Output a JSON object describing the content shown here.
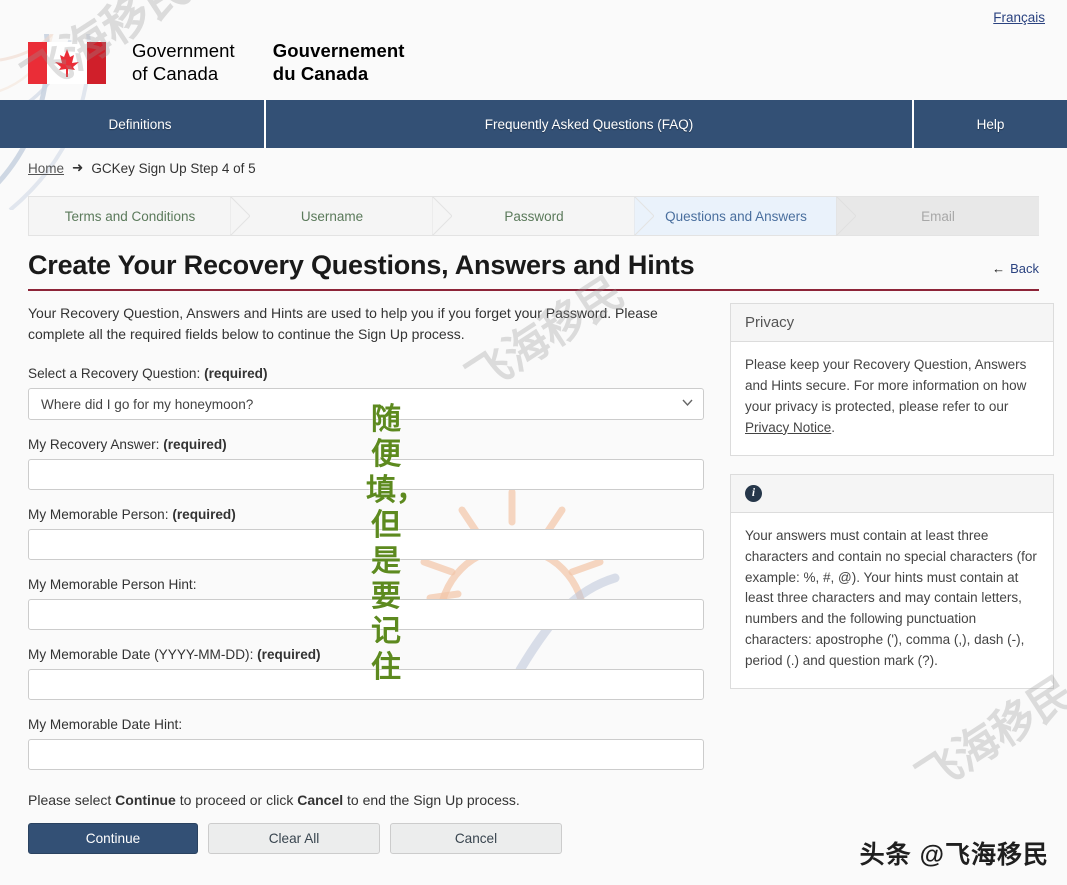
{
  "topbar": {
    "language_link": "Français"
  },
  "brand": {
    "en_line1": "Government",
    "en_line2": "of Canada",
    "fr_line1": "Gouvernement",
    "fr_line2": "du Canada",
    "flag_icon": "canada-flag-icon"
  },
  "nav": {
    "items": [
      {
        "label": "Definitions"
      },
      {
        "label": "Frequently Asked Questions (FAQ)"
      },
      {
        "label": "Help"
      }
    ]
  },
  "breadcrumb": {
    "home": "Home",
    "separator": "➜",
    "current": "GCKey Sign Up Step 4 of 5"
  },
  "steps": [
    {
      "label": "Terms and Conditions",
      "state": "done"
    },
    {
      "label": "Username",
      "state": "done"
    },
    {
      "label": "Password",
      "state": "done"
    },
    {
      "label": "Questions and Answers",
      "state": "active"
    },
    {
      "label": "Email",
      "state": "disabled"
    }
  ],
  "page": {
    "title": "Create Your Recovery Questions, Answers and Hints",
    "back_label": "Back",
    "back_arrow": "←",
    "intro": "Your Recovery Question, Answers and Hints are used to help you if you forget your Password. Please complete all the required fields below to continue the Sign Up process."
  },
  "form": {
    "recovery_question": {
      "label_text": "Select a Recovery Question:",
      "required_tag": "(required)",
      "value": "Where did I go for my honeymoon?",
      "options": [
        "Where did I go for my honeymoon?"
      ]
    },
    "recovery_answer": {
      "label_text": "My Recovery Answer:",
      "required_tag": "(required)",
      "value": "",
      "placeholder": ""
    },
    "memorable_person": {
      "label_text": "My Memorable Person:",
      "required_tag": "(required)",
      "value": "",
      "placeholder": ""
    },
    "memorable_person_hint": {
      "label_text": "My Memorable Person Hint:",
      "required_tag": "",
      "value": "",
      "placeholder": ""
    },
    "memorable_date": {
      "label_text": "My Memorable Date (YYYY-MM-DD):",
      "required_tag": "(required)",
      "value": "",
      "placeholder": ""
    },
    "memorable_date_hint": {
      "label_text": "My Memorable Date Hint:",
      "required_tag": "",
      "value": "",
      "placeholder": ""
    }
  },
  "footer": {
    "note_part1": "Please select ",
    "note_bold1": "Continue",
    "note_part2": " to proceed or click ",
    "note_bold2": "Cancel",
    "note_part3": " to end the Sign Up process.",
    "continue_label": "Continue",
    "clear_label": "Clear All",
    "cancel_label": "Cancel"
  },
  "sidebar": {
    "privacy": {
      "heading": "Privacy",
      "body_part1": "Please keep your Recovery Question, Answers and Hints secure. For more information on how your privacy is protected, please refer to our ",
      "link": "Privacy Notice",
      "body_part2": "."
    },
    "info": {
      "icon": "info-circle-icon",
      "body": "Your answers must contain at least three characters and contain no special characters (for example: %, #, @). Your hints must contain at least three characters and may contain letters, numbers and the following punctuation characters: apostrophe ('), comma (,), dash (-), period (.) and question mark (?)."
    }
  },
  "watermarks": {
    "annotation_green": "随便填，但是要记住",
    "bottom_right": "头条 @飞海移民",
    "diagonal": "飞海移民"
  },
  "colors": {
    "nav_blue": "#335075",
    "title_rule": "#8d2438",
    "active_step_bg": "#eaf2fb",
    "active_step_text": "#4a6f9e",
    "done_step_text": "#5b7a5b",
    "annotation_green": "#5d8a1f",
    "flag_red": "#ea2d37"
  }
}
